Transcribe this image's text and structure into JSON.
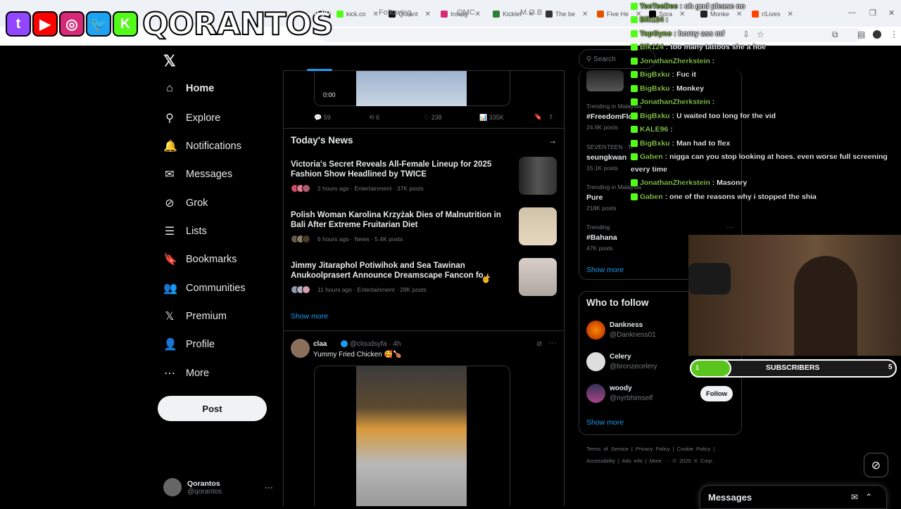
{
  "browser": {
    "tabs": [
      {
        "label": "kick.co",
        "color": "#53fc18"
      },
      {
        "label": "Qorant",
        "color": "#111"
      },
      {
        "label": "Instag",
        "color": "#d62976"
      },
      {
        "label": "Kicklet",
        "color": "#2e7d32"
      },
      {
        "label": "The be",
        "color": "#333"
      },
      {
        "label": "Five He",
        "color": "#e65100"
      },
      {
        "label": "Sora",
        "color": "#000"
      },
      {
        "label": "Monke",
        "color": "#222"
      },
      {
        "label": "r/Lives",
        "color": "#ff4500"
      }
    ]
  },
  "overlay": {
    "channel_name": "QORANTOS",
    "icons": [
      {
        "name": "twitch-icon",
        "glyph": "t",
        "color": "#9146ff"
      },
      {
        "name": "youtube-icon",
        "glyph": "▶",
        "color": "#ff0000"
      },
      {
        "name": "instagram-icon",
        "glyph": "◎",
        "color": "#d62976"
      },
      {
        "name": "twitter-icon",
        "glyph": "🐦",
        "color": "#1da1f2"
      },
      {
        "name": "kick-icon",
        "glyph": "K",
        "color": "#53fc18"
      }
    ]
  },
  "nav": {
    "logo": "𝕏",
    "items": [
      "Home",
      "Explore",
      "Notifications",
      "Messages",
      "Grok",
      "Lists",
      "Bookmarks",
      "Communities",
      "Premium",
      "Profile",
      "More"
    ],
    "icons": [
      "⌂",
      "⚲",
      "🔔",
      "✉",
      "⊘",
      "☰",
      "🔖",
      "👥",
      "𝕏",
      "👤",
      "⋯"
    ],
    "post": "Post"
  },
  "profile": {
    "name": "Qorantos",
    "handle": "@qorantos"
  },
  "feed": {
    "tabs": [
      "For you",
      "Following",
      "QMC",
      "M.O.B"
    ],
    "video_time": "0:00",
    "stats": {
      "replies": "59",
      "reposts": "6",
      "likes": "238",
      "views": "335K"
    },
    "today_news": "Today's News",
    "news": [
      {
        "title": "Victoria's Secret Reveals All-Female Lineup for 2025 Fashion Show Headlined by TWICE",
        "meta": "2 hours ago · Entertainment · 37K posts"
      },
      {
        "title": "Polish Woman Karolina Krzyżak Dies of Malnutrition in Bali After Extreme Fruitarian Diet",
        "meta": "6 hours ago · News · 5.4K posts"
      },
      {
        "title": "Jimmy Jitaraphol Potiwihok and Sea Tawinan Anukoolprasert Announce Dreamscape Fancon fo...",
        "meta": "11 hours ago · Entertainment · 28K posts"
      }
    ],
    "show_more": "Show more",
    "tweet": {
      "name": "claa",
      "handle": "@cloudsyfa",
      "time": "· 4h",
      "text": "Yummy Fried Chicken 🥰🍗"
    }
  },
  "sidebar": {
    "search": "Search",
    "trends": [
      {
        "label": "Trending in Malaysia",
        "title": "#FreedomFlo",
        "count": "24.6K posts"
      },
      {
        "label": "SEVENTEEN · Tr",
        "title": "seungkwan",
        "count": "15.1K posts"
      },
      {
        "label": "Trending in Malaysia",
        "title": "Pure",
        "count": "218K posts"
      },
      {
        "label": "Trending",
        "title": "#Bahana",
        "count": "47K posts"
      }
    ],
    "show_more": "Show more",
    "who_to_follow": "Who to follow",
    "follow": [
      {
        "name": "Dankness",
        "handle": "@Dankness01"
      },
      {
        "name": "Celery",
        "handle": "@bronzecelery"
      },
      {
        "name": "woody",
        "handle": "@nyrbhimself"
      }
    ],
    "follow_button": "Follow",
    "show_more2": "Show more",
    "footer1": "Terms of Service  |  Privacy Policy  |  Cookie Policy  |",
    "footer2": "Accessibility  |  Ads info  |  More ···  © 2025 X Corp."
  },
  "chat": [
    {
      "user": "TeeTeeDee",
      "msg": "oh god please no"
    },
    {
      "user": "Blk124",
      "msg": ""
    },
    {
      "user": "TopGyno",
      "msg": "horny ass mf"
    },
    {
      "user": "Blk124",
      "msg": "too many tattoos she a hoe"
    },
    {
      "user": "JonathanZherkstein",
      "msg": ""
    },
    {
      "user": "BigBxku",
      "msg": "Fuc it"
    },
    {
      "user": "BigBxku",
      "msg": "Monkey"
    },
    {
      "user": "JonathanZherkstein",
      "msg": ""
    },
    {
      "user": "BigBxku",
      "msg": "U waited too long for the vid"
    },
    {
      "user": "KALE96",
      "msg": ""
    },
    {
      "user": "BigBxku",
      "msg": "Man had to flex"
    },
    {
      "user": "Gaben",
      "msg": "nigga can you stop looking at hoes. even worse full screening"
    },
    {
      "user": "",
      "msg": "every time"
    },
    {
      "user": "JonathanZherkstein",
      "msg": "Masonry"
    },
    {
      "user": "Gaben",
      "msg": "one of the reasons why i stopped        the shia"
    }
  ],
  "subs": {
    "label": "SUBSCRIBERS",
    "current": "1",
    "goal": "5",
    "progress": 0.2
  },
  "messages": {
    "title": "Messages"
  }
}
